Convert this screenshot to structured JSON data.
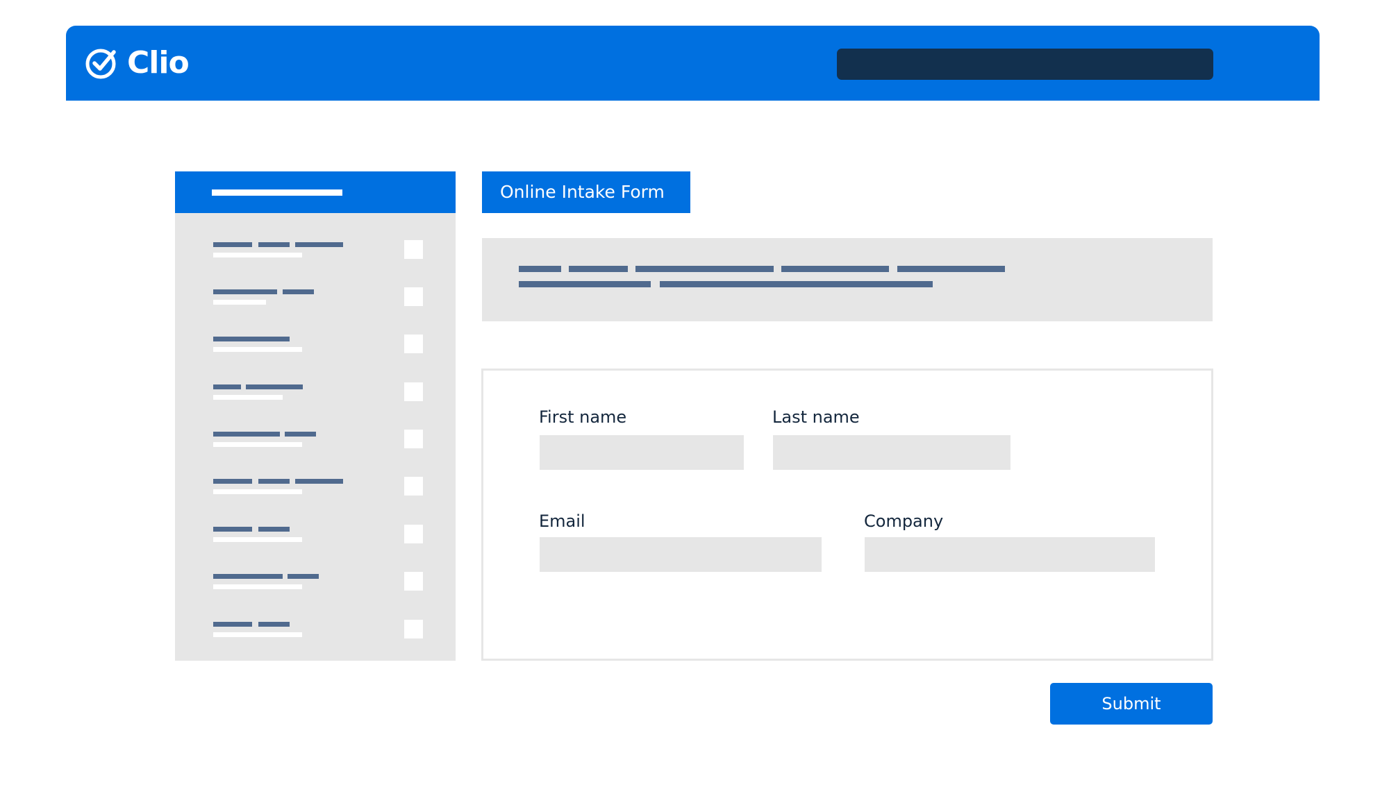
{
  "app": {
    "name": "Clio",
    "logo_icon": "check-circle-icon"
  },
  "form": {
    "tab_label": "Online Intake Form",
    "fields": {
      "first_name": {
        "label": "First name",
        "value": ""
      },
      "last_name": {
        "label": "Last name",
        "value": ""
      },
      "email": {
        "label": "Email",
        "value": ""
      },
      "company": {
        "label": "Company",
        "value": ""
      }
    },
    "submit_label": "Submit"
  },
  "colors": {
    "brand_blue": "#0070e0",
    "dark_navy": "#12304e",
    "placeholder_bar": "#506a8e",
    "panel_gray": "#e6e6e6"
  }
}
